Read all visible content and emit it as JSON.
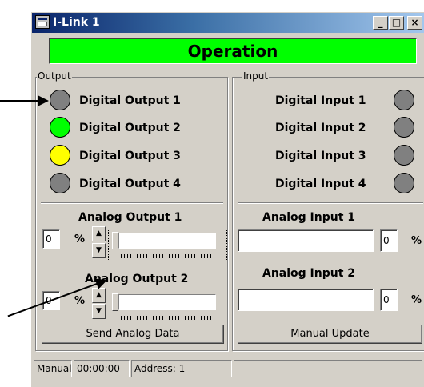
{
  "window": {
    "title": "I-Link 1"
  },
  "caption_buttons": {
    "minimize": "_",
    "maximize": "□",
    "close": "×"
  },
  "mode_banner": {
    "text": "Operation",
    "color": "#00ff00"
  },
  "output": {
    "group_label": "Output",
    "digital": [
      {
        "label": "Digital Output 1",
        "state": "off",
        "color": "#808080"
      },
      {
        "label": "Digital Output 2",
        "state": "on",
        "color": "#00ff00"
      },
      {
        "label": "Digital Output 3",
        "state": "on",
        "color": "#ffff00"
      },
      {
        "label": "Digital Output 4",
        "state": "off",
        "color": "#808080"
      }
    ],
    "analog": [
      {
        "label": "Analog Output 1",
        "value": "0",
        "unit": "%",
        "slider_fraction": 0
      },
      {
        "label": "Analog Output 2",
        "value": "0",
        "unit": "%",
        "slider_fraction": 0
      }
    ],
    "send_button": "Send Analog Data"
  },
  "input": {
    "group_label": "Input",
    "digital": [
      {
        "label": "Digital Input 1",
        "state": "off",
        "color": "#808080"
      },
      {
        "label": "Digital Input 2",
        "state": "off",
        "color": "#808080"
      },
      {
        "label": "Digital Input 3",
        "state": "off",
        "color": "#808080"
      },
      {
        "label": "Digital Input 4",
        "state": "off",
        "color": "#808080"
      }
    ],
    "analog": [
      {
        "label": "Analog Input 1",
        "value": "0",
        "unit": "%",
        "bar_text": ""
      },
      {
        "label": "Analog Input 2",
        "value": "0",
        "unit": "%",
        "bar_text": ""
      }
    ],
    "update_button": "Manual Update"
  },
  "statusbar": {
    "mode": "Manual",
    "time": "00:00:00",
    "address": "Address: 1"
  }
}
